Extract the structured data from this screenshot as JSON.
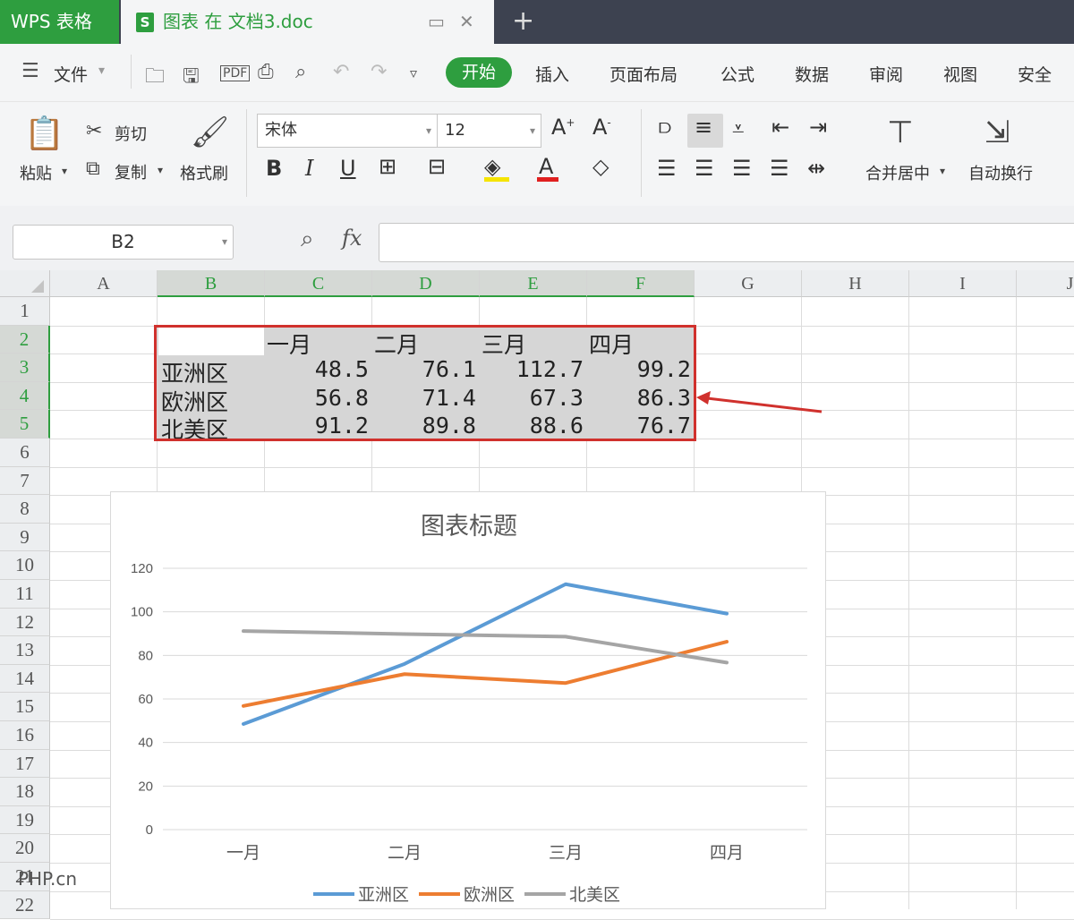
{
  "titlebar": {
    "app_tab": "WPS 表格",
    "doc_icon": "S",
    "doc_tab": "图表 在 文档3.doc",
    "new_tab": "+"
  },
  "menubar": {
    "file": "文件",
    "tabs": [
      "开始",
      "插入",
      "页面布局",
      "公式",
      "数据",
      "审阅",
      "视图",
      "安全"
    ]
  },
  "ribbon": {
    "paste": "粘贴",
    "cut": "剪切",
    "copy": "复制",
    "format_painter": "格式刷",
    "font_name": "宋体",
    "font_size": "12",
    "merge_center": "合并居中",
    "wrap_text": "自动换行"
  },
  "formula_bar": {
    "name_box": "B2",
    "fx": "fx",
    "formula": ""
  },
  "sheet": {
    "columns": [
      "A",
      "B",
      "C",
      "D",
      "E",
      "F",
      "G",
      "H",
      "I",
      "J"
    ],
    "rows": [
      "1",
      "2",
      "3",
      "4",
      "5",
      "6",
      "7",
      "8",
      "9",
      "10",
      "11",
      "12",
      "13",
      "14",
      "15",
      "16",
      "17",
      "18",
      "19",
      "20",
      "21",
      "22"
    ],
    "table": {
      "header": [
        "一月",
        "二月",
        "三月",
        "四月"
      ],
      "rows": [
        {
          "label": "亚洲区",
          "values": [
            "48.5",
            "76.1",
            "112.7",
            "99.2"
          ]
        },
        {
          "label": "欧洲区",
          "values": [
            "56.8",
            "71.4",
            "67.3",
            "86.3"
          ]
        },
        {
          "label": "北美区",
          "values": [
            "91.2",
            "89.8",
            "88.6",
            "76.7"
          ]
        }
      ]
    }
  },
  "chart_data": {
    "type": "line",
    "title": "图表标题",
    "categories": [
      "一月",
      "二月",
      "三月",
      "四月"
    ],
    "series": [
      {
        "name": "亚洲区",
        "color": "#5b9bd5",
        "values": [
          48.5,
          76.1,
          112.7,
          99.2
        ]
      },
      {
        "name": "欧洲区",
        "color": "#ed7d31",
        "values": [
          56.8,
          71.4,
          67.3,
          86.3
        ]
      },
      {
        "name": "北美区",
        "color": "#a5a5a5",
        "values": [
          91.2,
          89.8,
          88.6,
          76.7
        ]
      }
    ],
    "yticks": [
      "0",
      "20",
      "40",
      "60",
      "80",
      "100",
      "120"
    ],
    "ylim": [
      0,
      120
    ],
    "grid": true,
    "legend": "bottom"
  },
  "annotation": {
    "highlight_color": "#d0312d"
  },
  "watermark": "PHP.cn"
}
